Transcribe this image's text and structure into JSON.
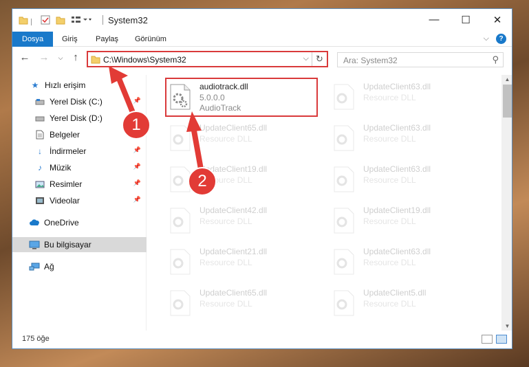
{
  "window": {
    "title": "System32",
    "minimize": "—",
    "maximize": "☐",
    "close": "✕"
  },
  "ribbon": {
    "tabs": [
      "Dosya",
      "Giriş",
      "Paylaş",
      "Görünüm"
    ],
    "help": "?"
  },
  "address": {
    "path": "C:\\Windows\\System32",
    "search_placeholder": "Ara: System32"
  },
  "nav": {
    "quick_access": "Hızlı erişim",
    "items": [
      {
        "label": "Yerel Disk (C:)",
        "icon": "drive-icon"
      },
      {
        "label": "Yerel Disk (D:)",
        "icon": "drive-icon"
      },
      {
        "label": "Belgeler",
        "icon": "documents-icon"
      },
      {
        "label": "İndirmeler",
        "icon": "downloads-icon"
      },
      {
        "label": "Müzik",
        "icon": "music-icon"
      },
      {
        "label": "Resimler",
        "icon": "pictures-icon"
      },
      {
        "label": "Videolar",
        "icon": "videos-icon"
      }
    ],
    "onedrive": "OneDrive",
    "this_pc": "Bu bilgisayar",
    "network": "Ağ"
  },
  "files": {
    "highlighted": {
      "name": "audiotrack.dll",
      "version": "5.0.0.0",
      "description": "AudioTrack"
    },
    "left_column": [
      {
        "name": "UpdateClient65.dll",
        "desc": "Resource DLL"
      },
      {
        "name": "UpdateClient19.dll",
        "desc": "Resource DLL"
      },
      {
        "name": "UpdateClient42.dll",
        "desc": "Resource DLL"
      },
      {
        "name": "UpdateClient21.dll",
        "desc": "Resource DLL"
      },
      {
        "name": "UpdateClient65.dll",
        "desc": "Resource DLL"
      }
    ],
    "right_column": [
      {
        "name": "UpdateClient63.dll",
        "desc": "Resource DLL"
      },
      {
        "name": "UpdateClient63.dll",
        "desc": "Resource DLL"
      },
      {
        "name": "UpdateClient63.dll",
        "desc": "Resource DLL"
      },
      {
        "name": "UpdateClient19.dll",
        "desc": "Resource DLL"
      },
      {
        "name": "UpdateClient63.dll",
        "desc": "Resource DLL"
      },
      {
        "name": "UpdateClient5.dll",
        "desc": "Resource DLL"
      }
    ]
  },
  "status": {
    "item_count": "175 öğe"
  },
  "annotations": {
    "step1": "1",
    "step2": "2",
    "color": "#e23b36"
  }
}
